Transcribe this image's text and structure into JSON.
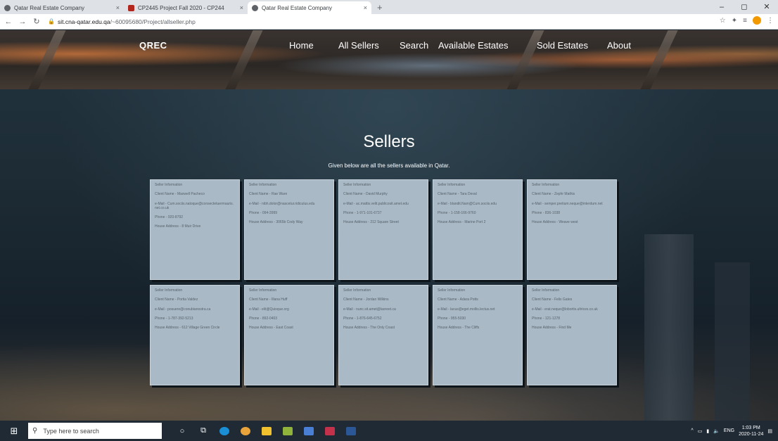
{
  "browser": {
    "tabs": [
      {
        "title": "Qatar Real Estate Company",
        "close": "×",
        "active": false
      },
      {
        "title": "CP2445 Project Fall 2020 - CP244",
        "close": "×",
        "active": false
      },
      {
        "title": "Qatar Real Estate Company",
        "close": "×",
        "active": true
      }
    ],
    "new_tab": "+",
    "window_controls": [
      "–",
      "◻",
      "✕"
    ],
    "address": {
      "host": "sit.cna-qatar.edu.qa",
      "path": "/~60095680/Project/allseller.php"
    }
  },
  "site": {
    "logo": "QREC",
    "nav": [
      "Home",
      "All Sellers",
      "Search",
      "Available Estates",
      "Sold Estates",
      "About"
    ],
    "title": "Sellers",
    "subtitle": "Given below are all the sellers available in Qatar."
  },
  "cards": [
    {
      "label": "Seller Information",
      "name": "Client Name - Maxwell Pacheco",
      "email": "e-Mail - Cum.sociis.natoque@consectetuermauris.net.co.uk",
      "phone": "Phone - 920-8792",
      "address": "House Address - 8 Muir Drive"
    },
    {
      "label": "Seller Information",
      "name": "Client Name - Rae Ware",
      "email": "e-Mail - nibh.dolor@nascetur.ridiculus.edu",
      "phone": "Phone - 094-3999",
      "address": "House Address - 3065b Cody Way"
    },
    {
      "label": "Seller Information",
      "name": "Client Name - David Murphy",
      "email": "e-Mail - ac.mattis.velit.publicosit.amet.edu",
      "phone": "Phone - 1-971-101-6737",
      "address": "House Address - 212 Square Street"
    },
    {
      "label": "Seller Information",
      "name": "Client Name - Tara Deval",
      "email": "e-Mail - blandit.Nam@Cum.sociis.edu",
      "phone": "Phone - 1-158-166-9760",
      "address": "House Address - Marine Port 2"
    },
    {
      "label": "Seller Information",
      "name": "Client Name - Zephr Mathis",
      "email": "e-Mail - semper.pretium.neque@interdum.net",
      "phone": "Phone - 836-1038",
      "address": "House Address - Weave west"
    },
    {
      "label": "Seller Information",
      "name": "Client Name - Portia Valdez",
      "email": "e-Mail - posuere@conubianostra.ca",
      "phone": "Phone - 1-787-392-5213",
      "address": "House Address - 612 Village Green Circle"
    },
    {
      "label": "Seller Information",
      "name": "Client Name - Illana Huff",
      "email": "e-Mail - elit@Quisque.org",
      "phone": "Phone - 892-0403",
      "address": "House Address - East Coast"
    },
    {
      "label": "Seller Information",
      "name": "Client Name - Jordan Wilkins",
      "email": "e-Mail - nunc.sit.amet@laoreet.ca",
      "phone": "Phone - 1-876-645-6752",
      "address": "House Address - The Only Coast"
    },
    {
      "label": "Seller Information",
      "name": "Client Name - Adara Potts",
      "email": "e-Mail - lacus@eget.mollis.lectus.net",
      "phone": "Phone - 955-5030",
      "address": "House Address - The Cliffs"
    },
    {
      "label": "Seller Information",
      "name": "Client Name - Felix Gates",
      "email": "e-Mail - erat.neque@lobortis.ultrices.co.uk",
      "phone": "Phone - 121-1278",
      "address": "House Address - Find Me"
    }
  ],
  "taskbar": {
    "search_placeholder": "Type here to search",
    "tray_lang": "ENG",
    "time": "1:03 PM",
    "date": "2020-11-24"
  }
}
